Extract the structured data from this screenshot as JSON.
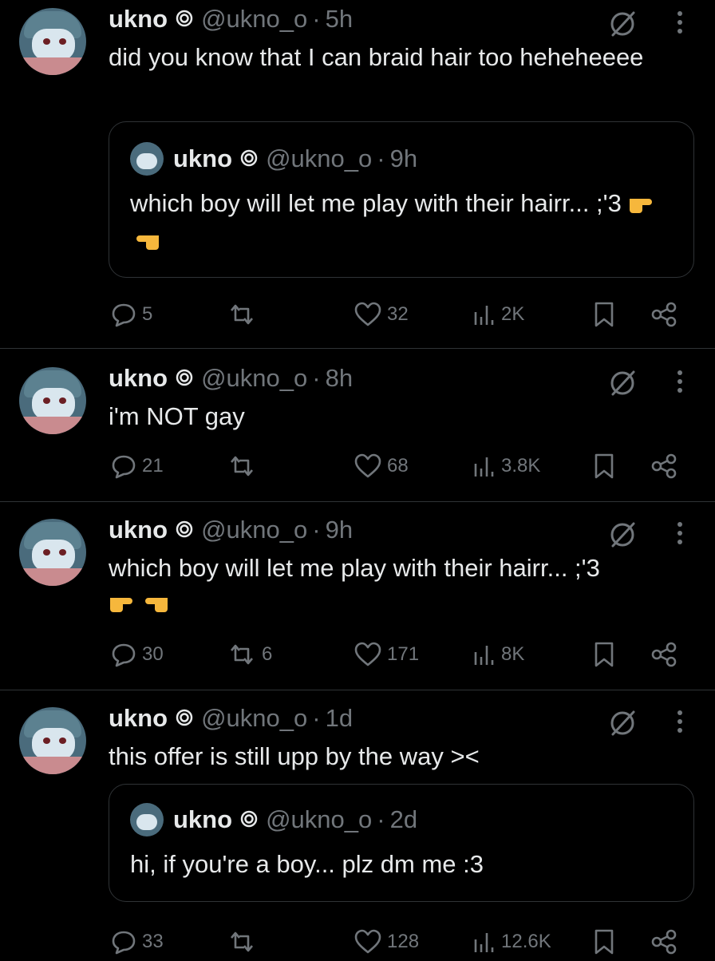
{
  "tweets": [
    {
      "name": "ukno",
      "handle": "@ukno_o",
      "time": "5h",
      "text": "did you know that I can braid hair too heheheeee",
      "quote": {
        "name": "ukno",
        "handle": "@ukno_o",
        "time": "9h",
        "text": "which boy will let me play with their hairr... ;'3"
      },
      "actions": {
        "replies": "5",
        "reposts": "",
        "likes": "32",
        "views": "2K"
      }
    },
    {
      "name": "ukno",
      "handle": "@ukno_o",
      "time": "8h",
      "text": "i'm NOT gay",
      "actions": {
        "replies": "21",
        "reposts": "",
        "likes": "68",
        "views": "3.8K"
      }
    },
    {
      "name": "ukno",
      "handle": "@ukno_o",
      "time": "9h",
      "text": "which boy will let me play with their hairr... ;'3",
      "actions": {
        "replies": "30",
        "reposts": "6",
        "likes": "171",
        "views": "8K"
      }
    },
    {
      "name": "ukno",
      "handle": "@ukno_o",
      "time": "1d",
      "text": "this offer is still upp by the way ><",
      "quote": {
        "name": "ukno",
        "handle": "@ukno_o",
        "time": "2d",
        "text": "hi, if you're a boy... plz dm me :3"
      },
      "actions": {
        "replies": "33",
        "reposts": "",
        "likes": "128",
        "views": "12.6K"
      }
    }
  ],
  "separator": "·",
  "icons": [
    "reply-icon",
    "repost-icon",
    "like-icon",
    "views-icon",
    "bookmark-icon",
    "share-icon",
    "grok-icon",
    "more-icon",
    "verified-spiral-icon",
    "pointing-right-emoji",
    "pointing-left-emoji"
  ],
  "colors": {
    "background": "#000000",
    "text": "#e7e9ea",
    "muted": "#71767b",
    "border": "#2f3336",
    "emoji": "#f6b73c"
  }
}
